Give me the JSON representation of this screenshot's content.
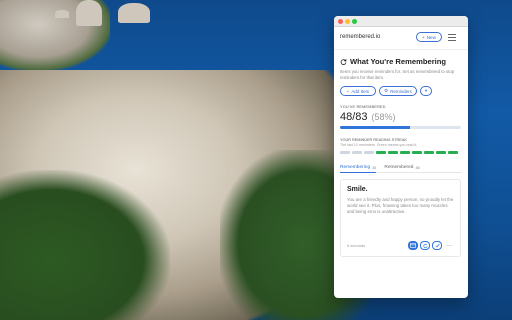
{
  "app": {
    "brand": "remembered.io",
    "new_button_label": "New",
    "heading": "What You're Remembering",
    "subtext": "Items you receive reminders for. Set as remembered to stop reminders for that item.",
    "actions": {
      "add_label": "Add Item",
      "reminders_label": "Reminders"
    },
    "progress": {
      "section_label": "YOU'VE REMEMBERED",
      "count_text": "48/83",
      "percent_text": "(58%)",
      "fraction": 0.58
    },
    "streak": {
      "title": "YOUR REMINDER READING STREAK",
      "subtitle": "The last 10 reminders. Green means you read it.",
      "segments": [
        false,
        false,
        false,
        true,
        true,
        true,
        true,
        true,
        true,
        true
      ]
    },
    "tabs": [
      {
        "label": "Remembering",
        "badge": "35",
        "active": true
      },
      {
        "label": "Remembered",
        "badge": "48",
        "active": false
      }
    ],
    "card": {
      "title": "Smile.",
      "body": "You are a friendly and happy person, so proudly let the world see it. Plus, frowning takes too many muscles and being emo is unattractive.",
      "time": "5 seconds"
    }
  },
  "colors": {
    "accent": "#2f74d8",
    "streak_on": "#27ae4f",
    "streak_off": "#cfd6df"
  }
}
